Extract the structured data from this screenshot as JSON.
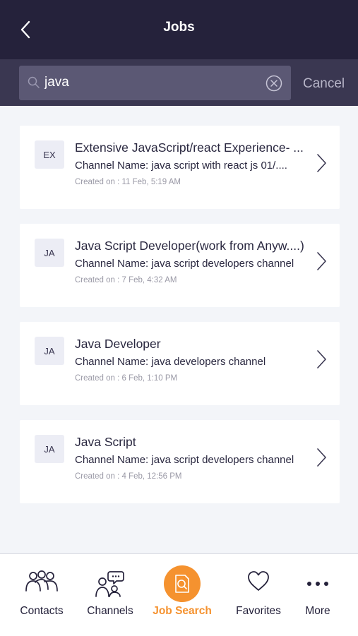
{
  "header": {
    "title": "Jobs",
    "back_icon": "back-chevron-icon"
  },
  "search": {
    "value": "java",
    "placeholder": "",
    "cancel_label": "Cancel"
  },
  "jobs": [
    {
      "avatar": "EX",
      "title": "Extensive JavaScript/react Experience- ...",
      "channel": "Channel Name: java script with react js 01/....",
      "created": "Created on : 11 Feb, 5:19 AM"
    },
    {
      "avatar": "JA",
      "title": "Java Script Developer(work from Anyw....)",
      "channel": "Channel Name: java script developers channel",
      "created": "Created on : 7 Feb, 4:32 AM"
    },
    {
      "avatar": "JA",
      "title": "Java Developer",
      "channel": "Channel Name: java developers channel",
      "created": "Created on : 6 Feb, 1:10 PM"
    },
    {
      "avatar": "JA",
      "title": "Java Script",
      "channel": "Channel Name: java script developers channel",
      "created": "Created on : 4 Feb, 12:56 PM"
    }
  ],
  "tabs": [
    {
      "label": "Contacts",
      "icon": "contacts-icon"
    },
    {
      "label": "Channels",
      "icon": "channels-icon"
    },
    {
      "label": "Job Search",
      "icon": "job-search-icon",
      "active": true
    },
    {
      "label": "Favorites",
      "icon": "heart-icon"
    },
    {
      "label": "More",
      "icon": "more-dots-icon"
    }
  ],
  "colors": {
    "header": "#25223b",
    "accent": "#f5922f",
    "background": "#f3f5f9"
  }
}
